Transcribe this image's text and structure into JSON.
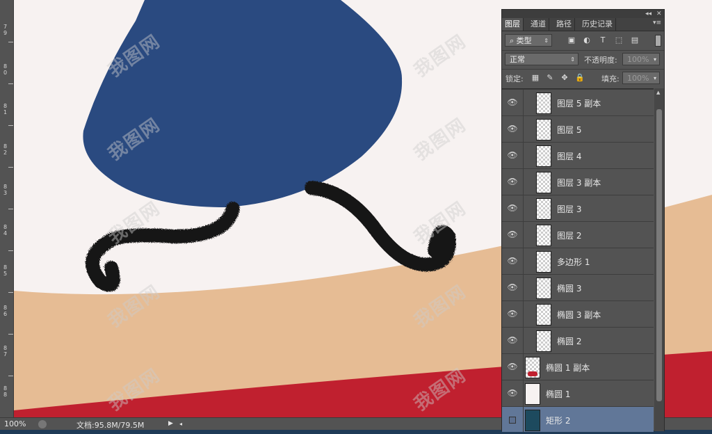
{
  "ruler": {
    "labels": [
      "7 9",
      "8 0",
      "8 1",
      "8 2",
      "8 3",
      "8 4",
      "8 5",
      "8 6",
      "8 7",
      "8 8"
    ]
  },
  "watermark": "我图网",
  "status": {
    "zoom": "100%",
    "doc": "文档:95.8M/79.5M"
  },
  "colors": {
    "sky": "#f7f2f1",
    "skin": "#e6bc94",
    "red": "#c0202f",
    "blue": "#2a4a80",
    "panel": "#535353",
    "selected_row": "#617798"
  },
  "panel": {
    "tabs": [
      "图层",
      "通道",
      "路径",
      "历史记录"
    ],
    "active_tab": "图层",
    "filter": {
      "label": "类型",
      "icons": [
        "image-filter-icon",
        "adjustment-filter-icon",
        "type-filter-icon",
        "shape-filter-icon",
        "smart-object-filter-icon"
      ]
    },
    "blend_mode": "正常",
    "opacity_label": "不透明度:",
    "opacity_value": "100%",
    "lock_label": "锁定:",
    "fill_label": "填充:",
    "fill_value": "100%"
  },
  "layers": [
    {
      "name": "图层 5 副本",
      "visible": true
    },
    {
      "name": "图层 5",
      "visible": true
    },
    {
      "name": "图层 4",
      "visible": true
    },
    {
      "name": "图层 3 副本",
      "visible": true
    },
    {
      "name": "图层 3",
      "visible": true
    },
    {
      "name": "图层 2",
      "visible": true
    },
    {
      "name": "多边形 1",
      "visible": true
    },
    {
      "name": "椭圆 3",
      "visible": true
    },
    {
      "name": "椭圆 3 副本",
      "visible": true
    },
    {
      "name": "椭圆 2",
      "visible": true
    },
    {
      "name": "椭圆 1 副本",
      "visible": true
    },
    {
      "name": "椭圆 1",
      "visible": true
    },
    {
      "name": "矩形 2",
      "visible": false,
      "selected": true
    }
  ]
}
